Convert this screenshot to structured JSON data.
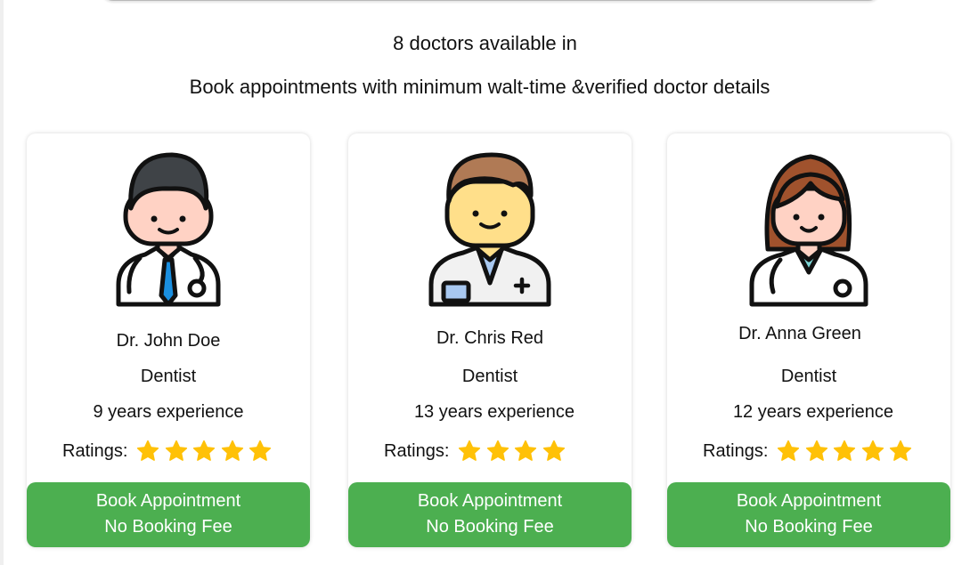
{
  "summary": {
    "available_text": "8 doctors available in",
    "subtitle": "Book appointments with minimum walt-time &verified doctor details"
  },
  "doctors": [
    {
      "name": "Dr. John Doe",
      "specialty": "Dentist",
      "experience": "9 years experience",
      "ratings_label": "Ratings:",
      "rating": 5,
      "avatar": "male-doctor-dark-hair-icon",
      "book_label": "Book Appointment",
      "fee_label": "No Booking Fee"
    },
    {
      "name": "Dr. Chris Red",
      "specialty": "Dentist",
      "experience": "13 years experience",
      "ratings_label": "Ratings:",
      "rating": 4,
      "avatar": "male-doctor-brown-hair-icon",
      "book_label": "Book Appointment",
      "fee_label": "No Booking Fee"
    },
    {
      "name": "Dr. Anna Green",
      "specialty": "Dentist",
      "experience": "12 years experience",
      "ratings_label": "Ratings:",
      "rating": 5,
      "avatar": "female-doctor-icon",
      "book_label": "Book Appointment",
      "fee_label": "No Booking Fee"
    }
  ],
  "colors": {
    "button": "#4caf50",
    "star": "#ffc107"
  }
}
